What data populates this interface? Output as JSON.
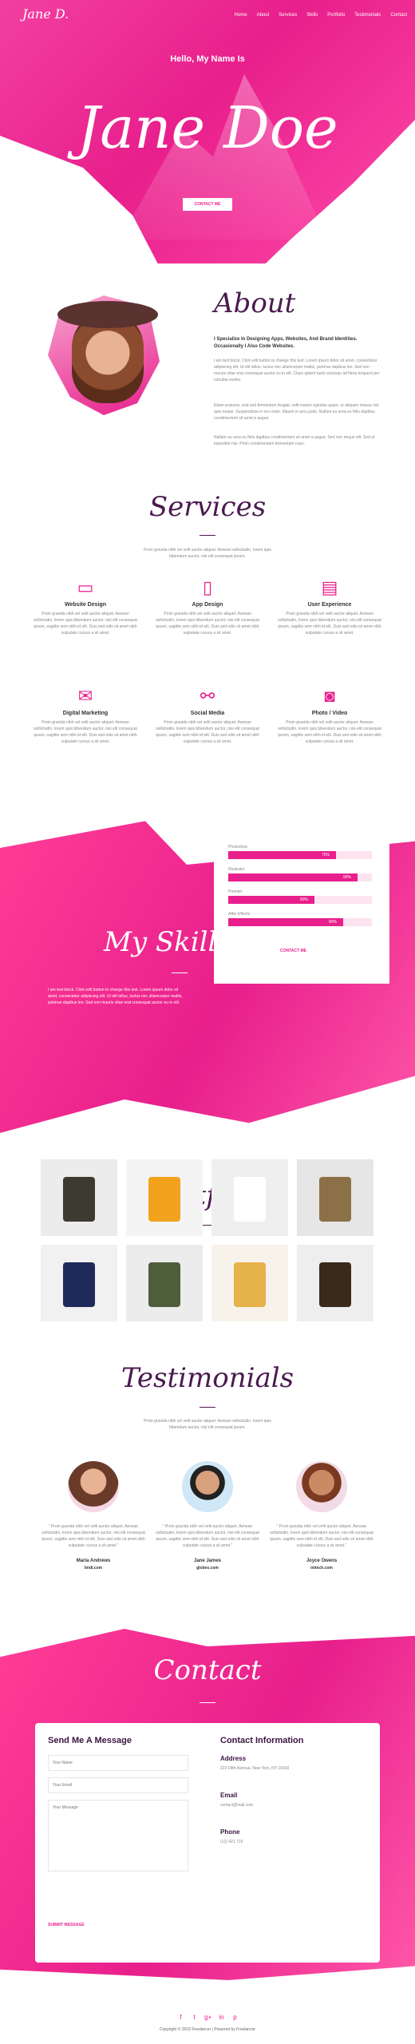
{
  "header": {
    "logo": "Jane D.",
    "nav": [
      "Home",
      "About",
      "Services",
      "Skills",
      "Portfolio",
      "Testimonials",
      "Contact"
    ]
  },
  "hero": {
    "greeting": "Hello, My Name Is",
    "name": "Jane Doe",
    "button": "CONTACT ME"
  },
  "about": {
    "title": "About",
    "lead": "I Specialize In Designing Apps, Websites, And Brand Identities. Occasionally I Also Code Websites.",
    "paragraphs": [
      "I am text block. Click edit button to change this text. Lorem ipsum dolor sit amet, consectetur adipiscing elit. Ut elit tellus, luctus nec ullamcorper mattis, pulvinar dapibus leo. Sed non mauris vitae erat consequat auctor eu in elit. Class aptent taciti sociosqu ad litora torquent per conubia nostra.",
      "Etiam posuere, erat sed fermentum feugiat, velit mauris egestas quam, ut aliquam massa nisl quis neque. Suspendisse in orci enim. Mauris in arcu justo. Nullam eu urna eu felis dapibus condimentum sit amet a augue.",
      "Nullam eu urna eu felis dapibus condimentum sit amet a augue. Sed non neque elit. Sed ut imperdiet nisi. Proin condimentum fermentum nunc."
    ]
  },
  "services": {
    "title": "Services",
    "subtitle": "Proin gravida nibh vel velit auctor aliquet. Aenean sollicitudin, lorem quis bibendum auctor, nisi elit consequat ipsum.",
    "items": [
      {
        "icon": "monitor-icon",
        "glyph": "▭",
        "title": "Website Design",
        "text": "Proin gravida nibh vel velit auctor aliquet. Aenean sollicitudin, lorem quis bibendum auctor, nisi elit consequat ipsum, sagittis sem nibh id elit. Duis sed odio sit amet nibh vulputate cursus a sit amet."
      },
      {
        "icon": "phone-icon",
        "glyph": "▯",
        "title": "App Design",
        "text": "Proin gravida nibh vel velit auctor aliquet. Aenean sollicitudin, lorem quis bibendum auctor, nisi elit consequat ipsum, sagittis sem nibh id elit. Duis sed odio sit amet nibh vulputate cursus a sit amet."
      },
      {
        "icon": "browser-icon",
        "glyph": "▤",
        "title": "User Experience",
        "text": "Proin gravida nibh vel velit auctor aliquet. Aenean sollicitudin, lorem quis bibendum auctor, nisi elit consequat ipsum, sagittis sem nibh id elit. Duis sed odio sit amet nibh vulputate cursus a sit amet."
      },
      {
        "icon": "envelope-icon",
        "glyph": "✉",
        "title": "Digital Marketing",
        "text": "Proin gravida nibh vel velit auctor aliquet. Aenean sollicitudin, lorem quis bibendum auctor, nisi elit consequat ipsum, sagittis sem nibh id elit. Duis sed odio sit amet nibh vulputate cursus a sit amet."
      },
      {
        "icon": "share-icon",
        "glyph": "⚯",
        "title": "Social Media",
        "text": "Proin gravida nibh vel velit auctor aliquet. Aenean sollicitudin, lorem quis bibendum auctor, nisi elit consequat ipsum, sagittis sem nibh id elit. Duis sed odio sit amet nibh vulputate cursus a sit amet."
      },
      {
        "icon": "camera-icon",
        "glyph": "◙",
        "title": "Photo / Video",
        "text": "Proin gravida nibh vel velit auctor aliquet. Aenean sollicitudin, lorem quis bibendum auctor, nisi elit consequat ipsum, sagittis sem nibh id elit. Duis sed odio sit amet nibh vulputate cursus a sit amet."
      }
    ]
  },
  "skills": {
    "title": "My Skills",
    "text": "I am text block. Click edit button to change this text. Lorem ipsum dolor sit amet, consectetur adipiscing elit. Ut elit tellus, luctus nec ullamcorper mattis, pulvinar dapibus leo. Sed non mauris vitae erat consequat auctor eu in elit.",
    "items": [
      {
        "label": "Photoshop",
        "value": 75,
        "pct": "75%"
      },
      {
        "label": "Illustrator",
        "value": 90,
        "pct": "90%"
      },
      {
        "label": "Premier",
        "value": 60,
        "pct": "60%"
      },
      {
        "label": "After Effects",
        "value": 80,
        "pct": "80%"
      }
    ],
    "button": "CONTACT ME"
  },
  "portfolio": {
    "title": "Portfolio",
    "items": [
      {
        "name": "coffee-bags",
        "bg": "#ececec",
        "fg": "#3d3a2f"
      },
      {
        "name": "orange-bottles",
        "bg": "#f4f4f4",
        "fg": "#f2a21c"
      },
      {
        "name": "white-bottle",
        "bg": "#efefef",
        "fg": "#ffffff"
      },
      {
        "name": "coffee-pouch",
        "bg": "#e6e6e6",
        "fg": "#8c7048"
      },
      {
        "name": "cream-tube",
        "bg": "#f1f1f1",
        "fg": "#1e2a5a"
      },
      {
        "name": "green-pouch",
        "bg": "#ececec",
        "fg": "#4f5e3a"
      },
      {
        "name": "snack-bowls",
        "bg": "#f7f3ea",
        "fg": "#e6b24a"
      },
      {
        "name": "jar",
        "bg": "#eeeeee",
        "fg": "#3a2a1a"
      }
    ]
  },
  "testimonials": {
    "title": "Testimonials",
    "subtitle": "Proin gravida nibh vel velit auctor aliquet. Aenean sollicitudin, lorem quis bibendum auctor, nisi elit consequat ipsum.",
    "items": [
      {
        "text": "\" Proin gravida nibh vel velit auctor aliquet. Aenean sollicitudin, lorem quis bibendum auctor, nisi elit consequat ipsum, sagittis sem nibh id elit. Duis sed odio sit amet nibh vulputate cursus a sit amet.\"",
        "name": "Maria Andrews",
        "company": "bndi.com"
      },
      {
        "text": "\" Proin gravida nibh vel velit auctor aliquet. Aenean sollicitudin, lorem quis bibendum auctor, nisi elit consequat ipsum, sagittis sem nibh id elit. Duis sed odio sit amet nibh vulputate cursus a sit amet.\"",
        "name": "Jane James",
        "company": "globex.com"
      },
      {
        "text": "\" Proin gravida nibh vel velit auctor aliquet. Aenean sollicitudin, lorem quis bibendum auctor, nisi elit consequat ipsum, sagittis sem nibh id elit. Duis sed odio sit amet nibh vulputate cursus a sit amet.\"",
        "name": "Joyce Owens",
        "company": "initech.com"
      }
    ]
  },
  "contact": {
    "title": "Contact",
    "form_title": "Send Me A Message",
    "name_placeholder": "Your Name",
    "email_placeholder": "Your Email",
    "message_placeholder": "Your Message",
    "submit": "SUBMIT MESSAGE",
    "info_title": "Contact Information",
    "address_label": "Address",
    "address": "223 Fifth Avenue, New York, NY 10160",
    "email_label": "Email",
    "email": "contact@mail.com",
    "phone_label": "Phone",
    "phone": "(12) 421 715"
  },
  "footer": {
    "social": [
      "f",
      "t",
      "g+",
      "in",
      "p"
    ],
    "copyright": "Copyright © 2019 Freelancer | Powered by Freelancer"
  },
  "colors": {
    "accent": "#e81f8c",
    "heading": "#4a1a4f"
  }
}
